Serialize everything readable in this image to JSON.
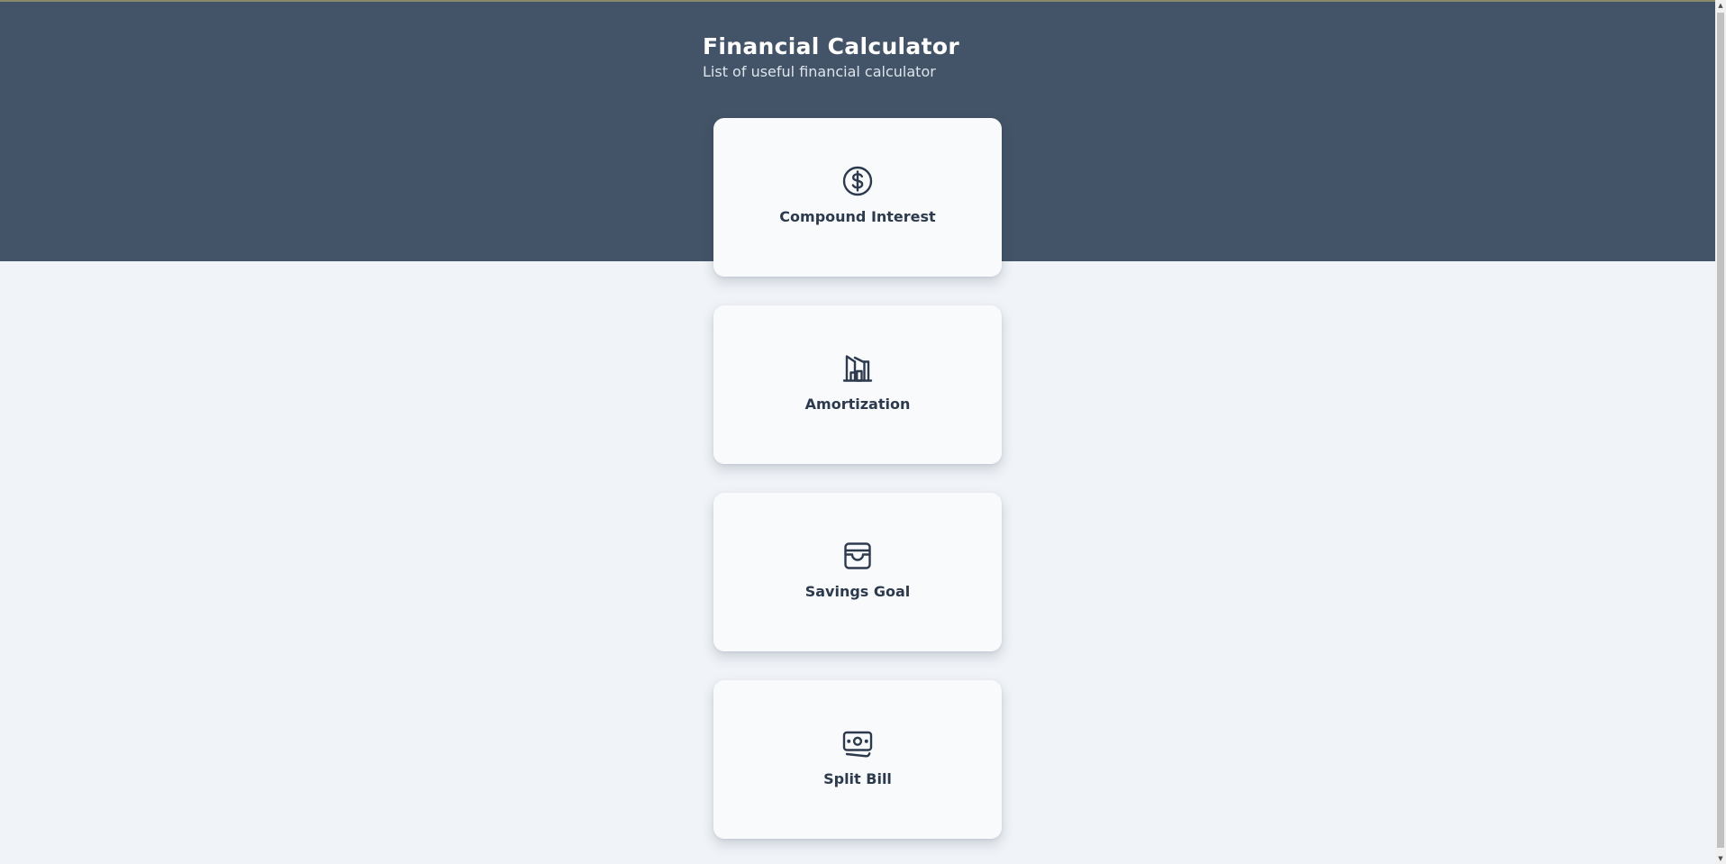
{
  "header": {
    "title": "Financial Calculator",
    "subtitle": "List of useful financial calculator",
    "background_color": "#445468"
  },
  "cards": [
    {
      "label": "Compound Interest",
      "icon": "dollar-circle-icon"
    },
    {
      "label": "Amortization",
      "icon": "building-icon"
    },
    {
      "label": "Savings Goal",
      "icon": "wallet-icon"
    },
    {
      "label": "Split Bill",
      "icon": "cash-icon"
    }
  ],
  "colors": {
    "page_background": "#f0f4f8",
    "card_background": "#f8fafc",
    "text_dark": "#2d3a4e"
  },
  "scrollbar": {
    "up_arrow": "▲",
    "down_arrow": "▼"
  }
}
